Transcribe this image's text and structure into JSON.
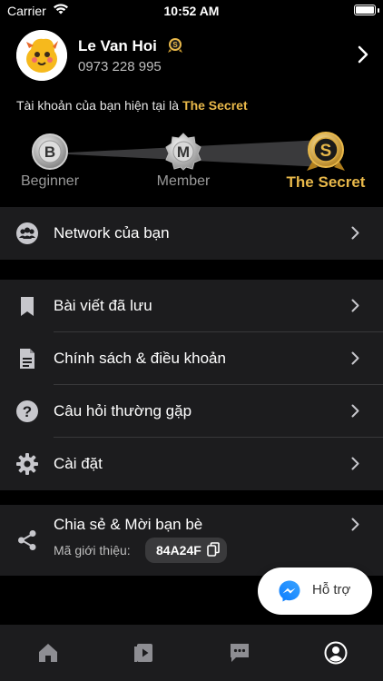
{
  "status": {
    "carrier": "Carrier",
    "time": "10:52 AM"
  },
  "profile": {
    "name": "Le Van Hoi",
    "phone": "0973 228 995"
  },
  "account": {
    "prefix": "Tài khoản của bạn hiện tại là",
    "tier": "The Secret"
  },
  "tiers": [
    {
      "letter": "B",
      "label": "Beginner"
    },
    {
      "letter": "M",
      "label": "Member"
    },
    {
      "letter": "S",
      "label": "The Secret"
    }
  ],
  "menu": {
    "network": "Network của bạn",
    "saved": "Bài viết đã lưu",
    "policy": "Chính sách & điều khoản",
    "faq": "Câu hỏi thường gặp",
    "settings": "Cài đặt",
    "share": "Chia sẻ & Mời bạn bè",
    "referral_label": "Mã giới thiệu:",
    "referral_code": "84A24F"
  },
  "support": {
    "label": "Hỗ trợ"
  },
  "colors": {
    "accent": "#e8b84a",
    "background": "#000000",
    "surface": "#1c1c1e"
  },
  "tabbar": {
    "items": [
      "home-icon",
      "video-icon",
      "chat-icon",
      "profile-icon"
    ],
    "active": 3
  }
}
